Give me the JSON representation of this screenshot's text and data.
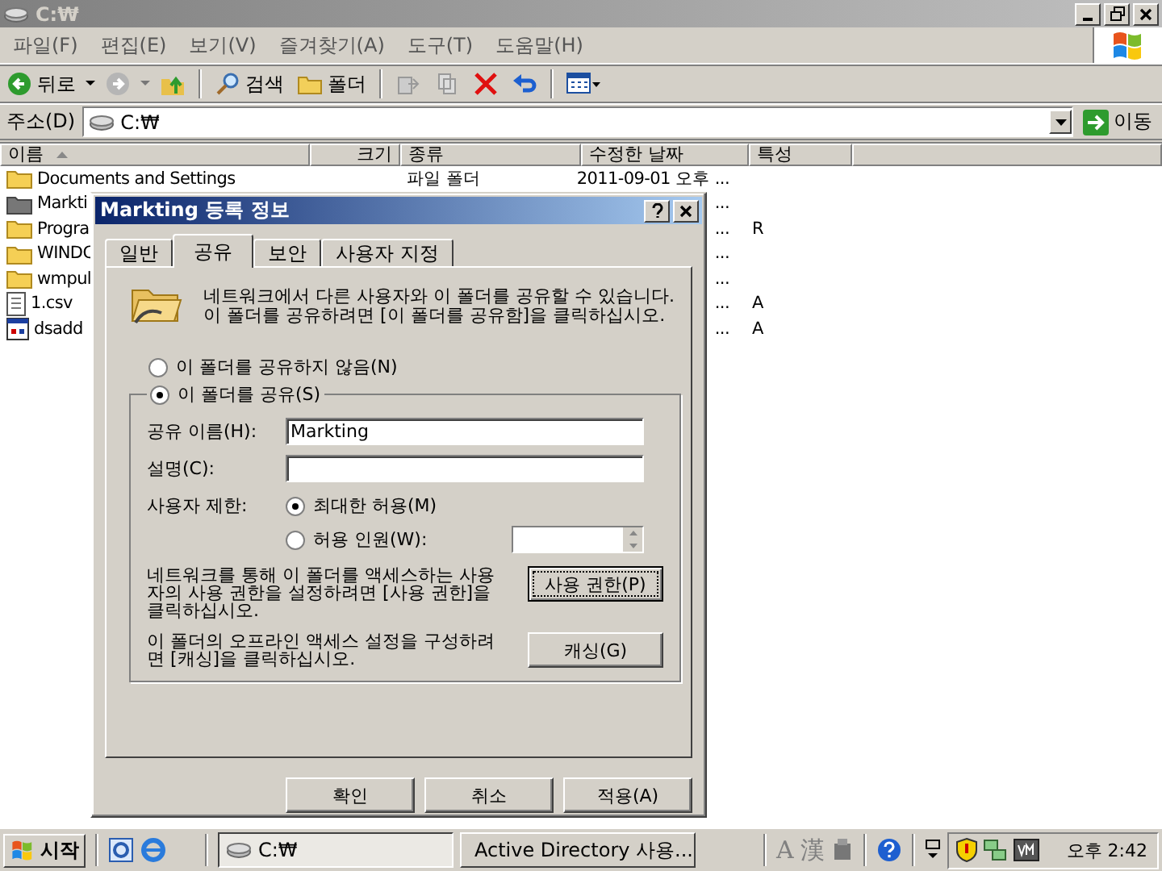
{
  "window": {
    "title": "C:₩"
  },
  "menu": [
    "파일(F)",
    "편집(E)",
    "보기(V)",
    "즐겨찾기(A)",
    "도구(T)",
    "도움말(H)"
  ],
  "toolbar": {
    "back": "뒤로",
    "search": "검색",
    "folders": "폴더"
  },
  "address": {
    "label": "주소(D)",
    "value": "C:₩",
    "go": "이동"
  },
  "columns": [
    "이름",
    "크기",
    "종류",
    "수정한 날짜",
    "특성"
  ],
  "rows": [
    {
      "kind": "folder",
      "name": "Documents and Settings",
      "type": "파일 폴더",
      "date": "2011-09-01 오후 ...",
      "attributes": ""
    },
    {
      "kind": "folder-dark",
      "name": "Markti",
      "type": "",
      "date": "...",
      "attributes": ""
    },
    {
      "kind": "folder",
      "name": "Progra",
      "type": "",
      "date": "...",
      "attributes": "R"
    },
    {
      "kind": "folder",
      "name": "WINDC",
      "type": "",
      "date": "...",
      "attributes": ""
    },
    {
      "kind": "folder",
      "name": "wmpul",
      "type": "",
      "date": "...",
      "attributes": ""
    },
    {
      "kind": "text-file",
      "name": "1.csv",
      "type": "",
      "date": "...",
      "attributes": "A"
    },
    {
      "kind": "program",
      "name": "dsadd",
      "type": "",
      "date": "...",
      "attributes": "A"
    }
  ],
  "dialog": {
    "title": "Markting 등록 정보",
    "tabs": [
      {
        "label": "일반",
        "selected": false
      },
      {
        "label": "공유",
        "selected": true
      },
      {
        "label": "보안",
        "selected": false
      },
      {
        "label": "사용자 지정",
        "selected": false
      }
    ],
    "intro": [
      "네트워크에서 다른 사용자와 이 폴더를 공유할 수 있습니다.",
      "이 폴더를 공유하려면 [이 폴더를 공유함]을 클릭하십시오."
    ],
    "share_options": [
      {
        "label": "이 폴더를 공유하지 않음(N)",
        "selected": false
      },
      {
        "label": "이 폴더를 공유(S)",
        "selected": true
      }
    ],
    "share_name": {
      "label": "공유 이름(H):",
      "value": "Markting"
    },
    "description": {
      "label": "설명(C):"
    },
    "user_limit": {
      "label": "사용자 제한:",
      "options": [
        {
          "label": "최대한 허용(M)",
          "selected": true
        },
        {
          "label": "허용 인원(W):",
          "selected": false
        }
      ]
    },
    "permissions_text": "네트워크를 통해 이 폴더를 액세스하는 사용자의 사용 권한을 설정하려면 [사용 권한]을 클릭하십시오.",
    "permissions_button": "사용 권한(P)",
    "caching_text": "이 폴더의 오프라인 액세스 설정을 구성하려면 [캐싱]을 클릭하십시오.",
    "caching_button": "캐싱(G)",
    "buttons": [
      "확인",
      "취소",
      "적용(A)"
    ]
  },
  "taskbar": {
    "start": "시작",
    "tasks": [
      {
        "label": "C:₩",
        "selected": true
      },
      {
        "label": "Active Directory 사용...",
        "selected": false
      }
    ],
    "ime": [
      "A",
      "漢"
    ],
    "clock": "오후 2:42"
  }
}
